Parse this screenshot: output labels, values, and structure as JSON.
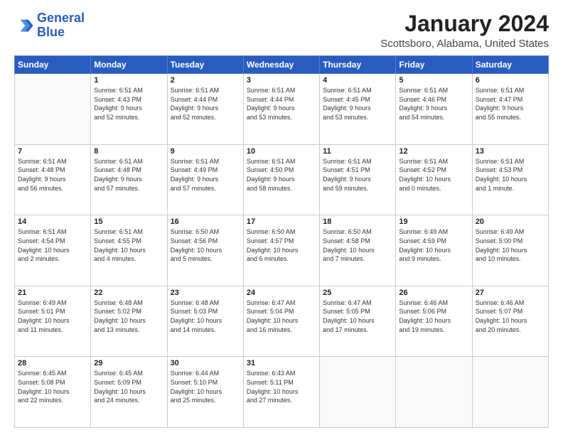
{
  "logo": {
    "line1": "General",
    "line2": "Blue"
  },
  "title": "January 2024",
  "subtitle": "Scottsboro, Alabama, United States",
  "days_of_week": [
    "Sunday",
    "Monday",
    "Tuesday",
    "Wednesday",
    "Thursday",
    "Friday",
    "Saturday"
  ],
  "weeks": [
    [
      {
        "day": "",
        "info": ""
      },
      {
        "day": "1",
        "info": "Sunrise: 6:51 AM\nSunset: 4:43 PM\nDaylight: 9 hours\nand 52 minutes."
      },
      {
        "day": "2",
        "info": "Sunrise: 6:51 AM\nSunset: 4:44 PM\nDaylight: 9 hours\nand 52 minutes."
      },
      {
        "day": "3",
        "info": "Sunrise: 6:51 AM\nSunset: 4:44 PM\nDaylight: 9 hours\nand 53 minutes."
      },
      {
        "day": "4",
        "info": "Sunrise: 6:51 AM\nSunset: 4:45 PM\nDaylight: 9 hours\nand 53 minutes."
      },
      {
        "day": "5",
        "info": "Sunrise: 6:51 AM\nSunset: 4:46 PM\nDaylight: 9 hours\nand 54 minutes."
      },
      {
        "day": "6",
        "info": "Sunrise: 6:51 AM\nSunset: 4:47 PM\nDaylight: 9 hours\nand 55 minutes."
      }
    ],
    [
      {
        "day": "7",
        "info": "Sunrise: 6:51 AM\nSunset: 4:48 PM\nDaylight: 9 hours\nand 56 minutes."
      },
      {
        "day": "8",
        "info": "Sunrise: 6:51 AM\nSunset: 4:48 PM\nDaylight: 9 hours\nand 57 minutes."
      },
      {
        "day": "9",
        "info": "Sunrise: 6:51 AM\nSunset: 4:49 PM\nDaylight: 9 hours\nand 57 minutes."
      },
      {
        "day": "10",
        "info": "Sunrise: 6:51 AM\nSunset: 4:50 PM\nDaylight: 9 hours\nand 58 minutes."
      },
      {
        "day": "11",
        "info": "Sunrise: 6:51 AM\nSunset: 4:51 PM\nDaylight: 9 hours\nand 59 minutes."
      },
      {
        "day": "12",
        "info": "Sunrise: 6:51 AM\nSunset: 4:52 PM\nDaylight: 10 hours\nand 0 minutes."
      },
      {
        "day": "13",
        "info": "Sunrise: 6:51 AM\nSunset: 4:53 PM\nDaylight: 10 hours\nand 1 minute."
      }
    ],
    [
      {
        "day": "14",
        "info": "Sunrise: 6:51 AM\nSunset: 4:54 PM\nDaylight: 10 hours\nand 2 minutes."
      },
      {
        "day": "15",
        "info": "Sunrise: 6:51 AM\nSunset: 4:55 PM\nDaylight: 10 hours\nand 4 minutes."
      },
      {
        "day": "16",
        "info": "Sunrise: 6:50 AM\nSunset: 4:56 PM\nDaylight: 10 hours\nand 5 minutes."
      },
      {
        "day": "17",
        "info": "Sunrise: 6:50 AM\nSunset: 4:57 PM\nDaylight: 10 hours\nand 6 minutes."
      },
      {
        "day": "18",
        "info": "Sunrise: 6:50 AM\nSunset: 4:58 PM\nDaylight: 10 hours\nand 7 minutes."
      },
      {
        "day": "19",
        "info": "Sunrise: 6:49 AM\nSunset: 4:59 PM\nDaylight: 10 hours\nand 9 minutes."
      },
      {
        "day": "20",
        "info": "Sunrise: 6:49 AM\nSunset: 5:00 PM\nDaylight: 10 hours\nand 10 minutes."
      }
    ],
    [
      {
        "day": "21",
        "info": "Sunrise: 6:49 AM\nSunset: 5:01 PM\nDaylight: 10 hours\nand 11 minutes."
      },
      {
        "day": "22",
        "info": "Sunrise: 6:48 AM\nSunset: 5:02 PM\nDaylight: 10 hours\nand 13 minutes."
      },
      {
        "day": "23",
        "info": "Sunrise: 6:48 AM\nSunset: 5:03 PM\nDaylight: 10 hours\nand 14 minutes."
      },
      {
        "day": "24",
        "info": "Sunrise: 6:47 AM\nSunset: 5:04 PM\nDaylight: 10 hours\nand 16 minutes."
      },
      {
        "day": "25",
        "info": "Sunrise: 6:47 AM\nSunset: 5:05 PM\nDaylight: 10 hours\nand 17 minutes."
      },
      {
        "day": "26",
        "info": "Sunrise: 6:46 AM\nSunset: 5:06 PM\nDaylight: 10 hours\nand 19 minutes."
      },
      {
        "day": "27",
        "info": "Sunrise: 6:46 AM\nSunset: 5:07 PM\nDaylight: 10 hours\nand 20 minutes."
      }
    ],
    [
      {
        "day": "28",
        "info": "Sunrise: 6:45 AM\nSunset: 5:08 PM\nDaylight: 10 hours\nand 22 minutes."
      },
      {
        "day": "29",
        "info": "Sunrise: 6:45 AM\nSunset: 5:09 PM\nDaylight: 10 hours\nand 24 minutes."
      },
      {
        "day": "30",
        "info": "Sunrise: 6:44 AM\nSunset: 5:10 PM\nDaylight: 10 hours\nand 25 minutes."
      },
      {
        "day": "31",
        "info": "Sunrise: 6:43 AM\nSunset: 5:11 PM\nDaylight: 10 hours\nand 27 minutes."
      },
      {
        "day": "",
        "info": ""
      },
      {
        "day": "",
        "info": ""
      },
      {
        "day": "",
        "info": ""
      }
    ]
  ]
}
